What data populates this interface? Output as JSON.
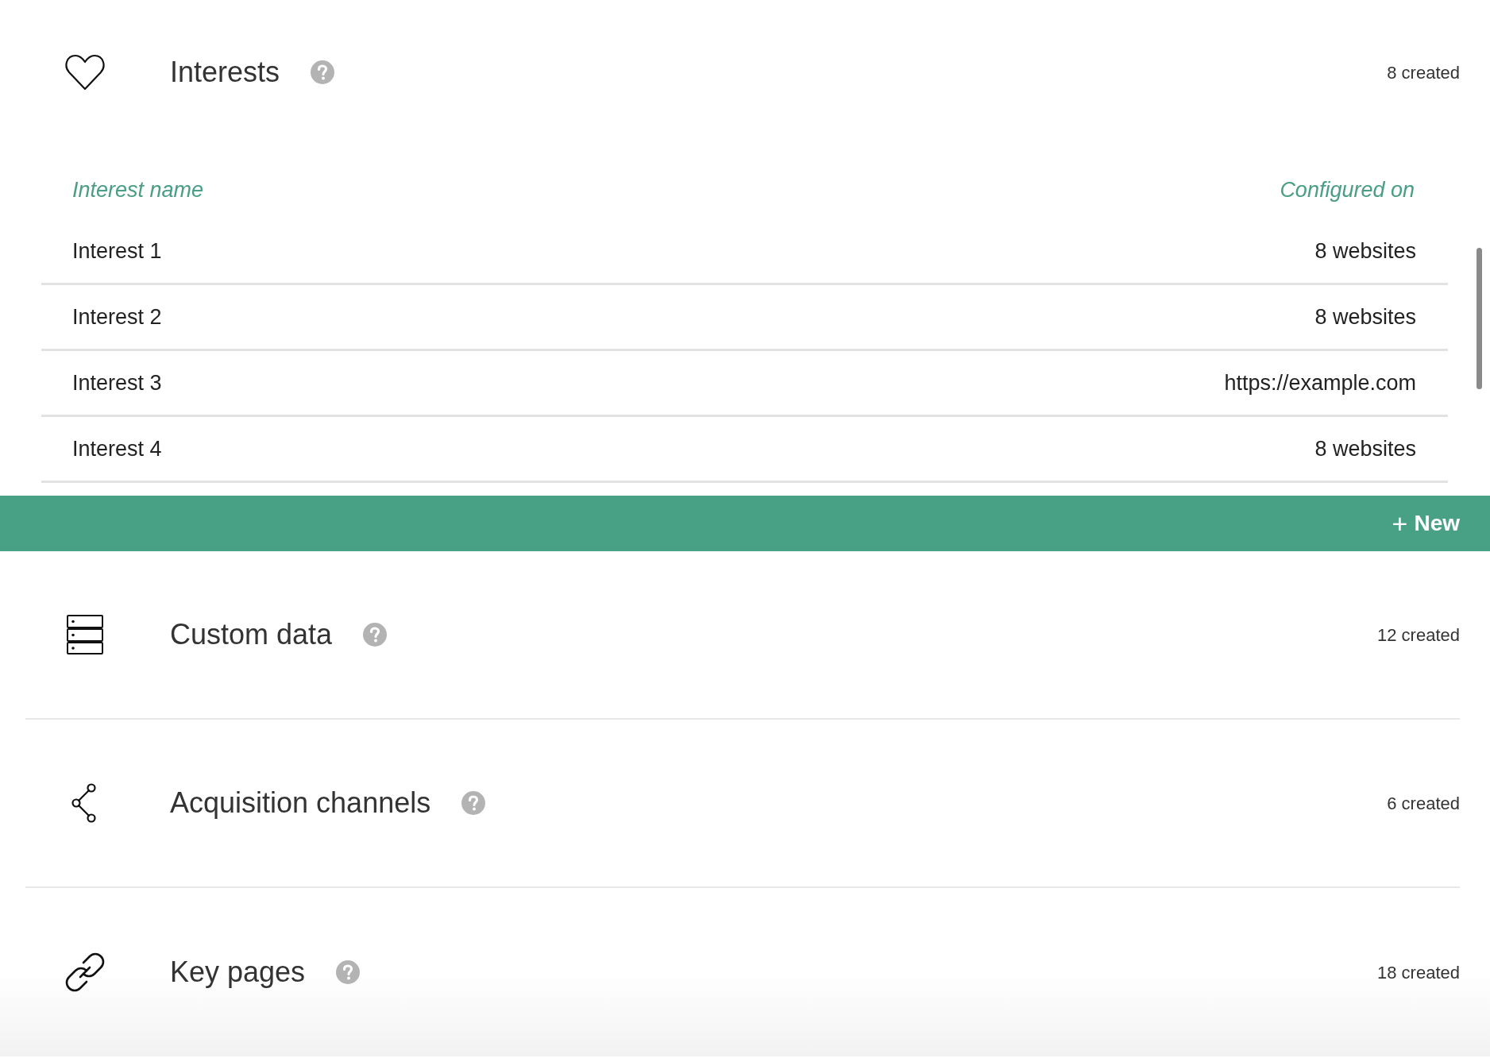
{
  "interests": {
    "kind": "heart",
    "title": "Interests",
    "count": "8 created",
    "table": {
      "columns": [
        "Interest name",
        "Configured on"
      ],
      "rows": [
        {
          "name": "Interest 1",
          "configured_on": "8 websites"
        },
        {
          "name": "Interest 2",
          "configured_on": "8 websites"
        },
        {
          "name": "Interest 3",
          "configured_on": "https://example.com"
        },
        {
          "name": "Interest 4",
          "configured_on": "8 websites"
        }
      ]
    },
    "new_button": {
      "icon": "+",
      "label": "New"
    }
  },
  "sections": [
    {
      "kind": "server",
      "title": "Custom data",
      "count": "12 created"
    },
    {
      "kind": "share",
      "title": "Acquisition channels",
      "count": "6 created"
    },
    {
      "kind": "link",
      "title": "Key pages",
      "count": "18 created"
    }
  ]
}
